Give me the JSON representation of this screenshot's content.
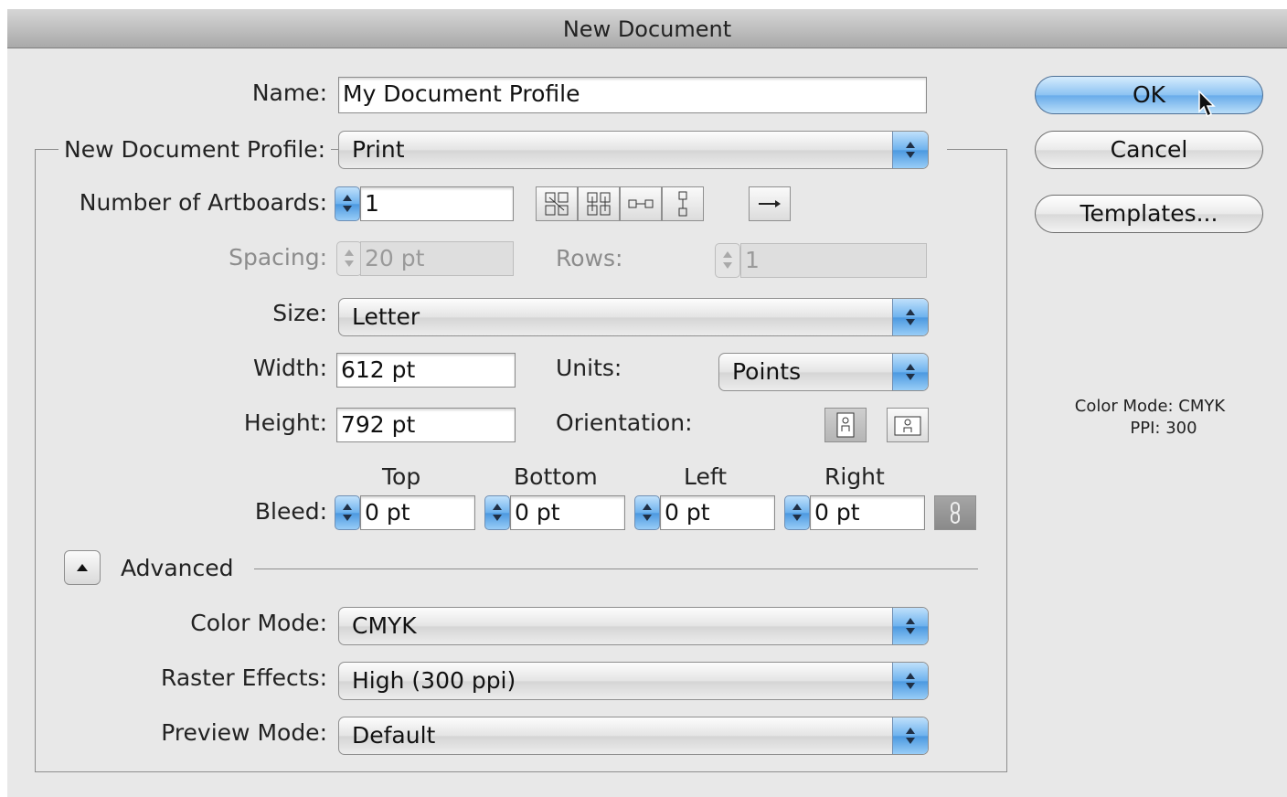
{
  "window": {
    "title": "New Document"
  },
  "form": {
    "name_label": "Name:",
    "name_value": "My Document Profile",
    "profile_label": "New Document Profile:",
    "profile_value": "Print",
    "artboards_label": "Number of Artboards:",
    "artboards_value": "1",
    "spacing_label": "Spacing:",
    "spacing_value": "20 pt",
    "rows_label": "Rows:",
    "rows_value": "1",
    "size_label": "Size:",
    "size_value": "Letter",
    "width_label": "Width:",
    "width_value": "612 pt",
    "units_label": "Units:",
    "units_value": "Points",
    "height_label": "Height:",
    "height_value": "792 pt",
    "orientation_label": "Orientation:",
    "bleed_label": "Bleed:",
    "bleed_headers": {
      "top": "Top",
      "bottom": "Bottom",
      "left": "Left",
      "right": "Right"
    },
    "bleed_values": {
      "top": "0 pt",
      "bottom": "0 pt",
      "left": "0 pt",
      "right": "0 pt"
    },
    "advanced_label": "Advanced",
    "color_mode_label": "Color Mode:",
    "color_mode_value": "CMYK",
    "raster_label": "Raster Effects:",
    "raster_value": "High (300 ppi)",
    "preview_label": "Preview Mode:",
    "preview_value": "Default"
  },
  "buttons": {
    "ok": "OK",
    "cancel": "Cancel",
    "templates": "Templates..."
  },
  "info": {
    "color_mode": "Color Mode: CMYK",
    "ppi": "PPI: 300"
  },
  "icons": {
    "artboard_layout": [
      "grid-by-row-icon",
      "grid-by-column-icon",
      "arrange-by-row-icon",
      "arrange-by-column-icon"
    ],
    "direction": "left-to-right-arrow-icon",
    "orientation": [
      "portrait-icon",
      "landscape-icon"
    ],
    "bleed_link": "link-bleed-icon",
    "advanced_toggle": "disclosure-up-icon"
  },
  "colors": {
    "accent": "#6eb2ee",
    "window_bg": "#e8e8e8"
  }
}
